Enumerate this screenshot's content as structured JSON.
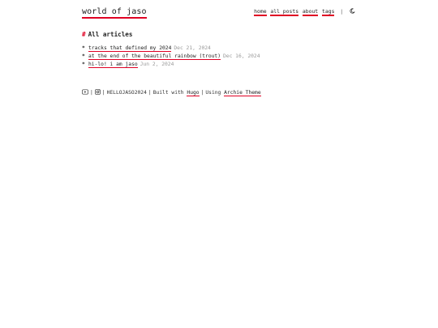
{
  "site": {
    "title": "world of jaso"
  },
  "nav": {
    "items": [
      "home",
      "all posts",
      "about",
      "tags"
    ],
    "separator": "|",
    "theme_toggle_icon": "moon-icon"
  },
  "main": {
    "heading_marker": "#",
    "heading": "All articles",
    "posts": [
      {
        "title": "tracks that defined my 2024",
        "date": "Dec 21, 2024"
      },
      {
        "title": "at the end of the beautiful rainbow (trout)",
        "date": "Dec 16, 2024"
      },
      {
        "title": "hi-lo! i am jaso",
        "date": "Jun 2, 2024"
      }
    ]
  },
  "footer": {
    "icons": [
      "youtube-icon",
      "instagram-icon"
    ],
    "copyright": "HELLOJASO2024",
    "built_with_label": "Built with",
    "built_with_link": "Hugo",
    "using_label": "Using",
    "theme_link": "Archie Theme",
    "separator": "|"
  },
  "colors": {
    "accent": "#e00023",
    "text": "#222222",
    "muted": "#999999"
  }
}
